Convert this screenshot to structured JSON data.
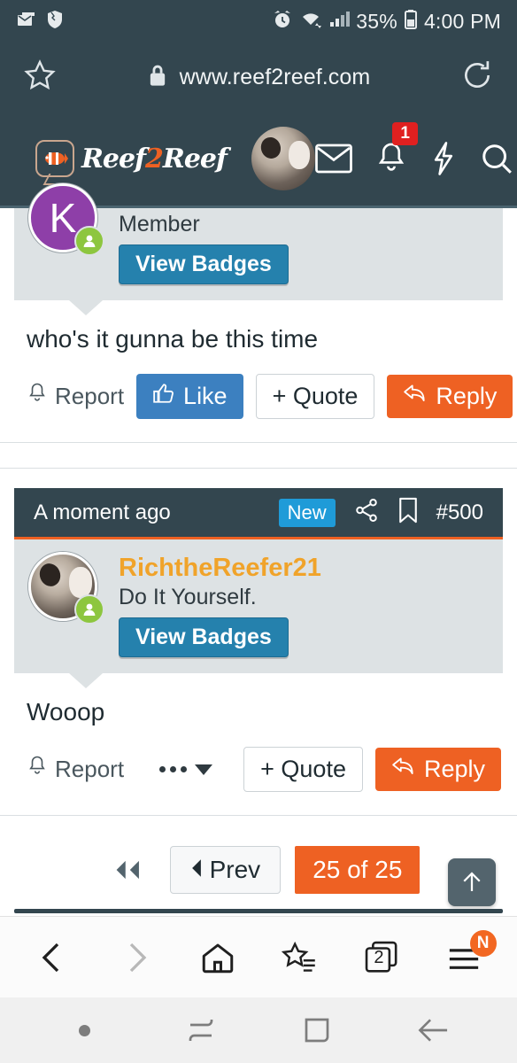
{
  "status_bar": {
    "left_icons": [
      "email-icon",
      "shield-icon"
    ],
    "right_icons": [
      "alarm-icon",
      "wifi-icon",
      "signal-icon",
      "battery-icon"
    ],
    "battery_percent": "35%",
    "time": "4:00 PM"
  },
  "browser": {
    "url": "www.reef2reef.com",
    "lock_icon": "lock-icon",
    "bookmark_icon": "star-icon",
    "reload_icon": "reload-icon",
    "nav": {
      "back": "back-chevron-icon",
      "forward": "forward-chevron-icon",
      "home": "home-icon",
      "bookmarks": "bookmarks-star-icon",
      "tabs_count": "2",
      "menu_badge": "N"
    }
  },
  "site_header": {
    "menu_icon": "hamburger-icon",
    "logo_text_1": "Reef",
    "logo_two": "2",
    "logo_text_2": "Reef",
    "avatar": "user-avatar",
    "icons": [
      "mail-icon",
      "bell-icon",
      "bolt-icon",
      "search-icon"
    ],
    "notification_count": "1"
  },
  "posts": [
    {
      "avatar_letter": "K",
      "user_title": "Member",
      "badges_label": "View Badges",
      "body": "who's it gunna be this time",
      "report_label": "Report",
      "like_label": "Like",
      "quote_label": "+ Quote",
      "reply_label": "Reply"
    },
    {
      "time": "A moment ago",
      "new_label": "New",
      "share_icon": "share-icon",
      "bookmark_icon": "bookmark-icon",
      "post_number": "#500",
      "username": "RichtheReefer21",
      "user_title": "Do It Yourself.",
      "badges_label": "View Badges",
      "body": "Wooop",
      "report_label": "Report",
      "more_label": "more-options",
      "quote_label": "+ Quote",
      "reply_label": "Reply"
    }
  ],
  "pagination": {
    "first_label": "first-page",
    "prev_label": "Prev",
    "current_label": "25 of 25",
    "scroll_top_icon": "arrow-up-icon"
  },
  "system_nav": {
    "dot": "dot-indicator",
    "recents": "recents-icon",
    "home": "home-square-icon",
    "back": "back-arrow-icon"
  },
  "colors": {
    "header_bg": "#33464f",
    "accent_orange": "#ee6123",
    "like_blue": "#3c80c0",
    "badge_blue": "#1f9bd8",
    "username_orange": "#f0a32a",
    "online_green": "#8dc63f",
    "avatar_purple": "#8e3fa8",
    "notification_red": "#e02020"
  }
}
